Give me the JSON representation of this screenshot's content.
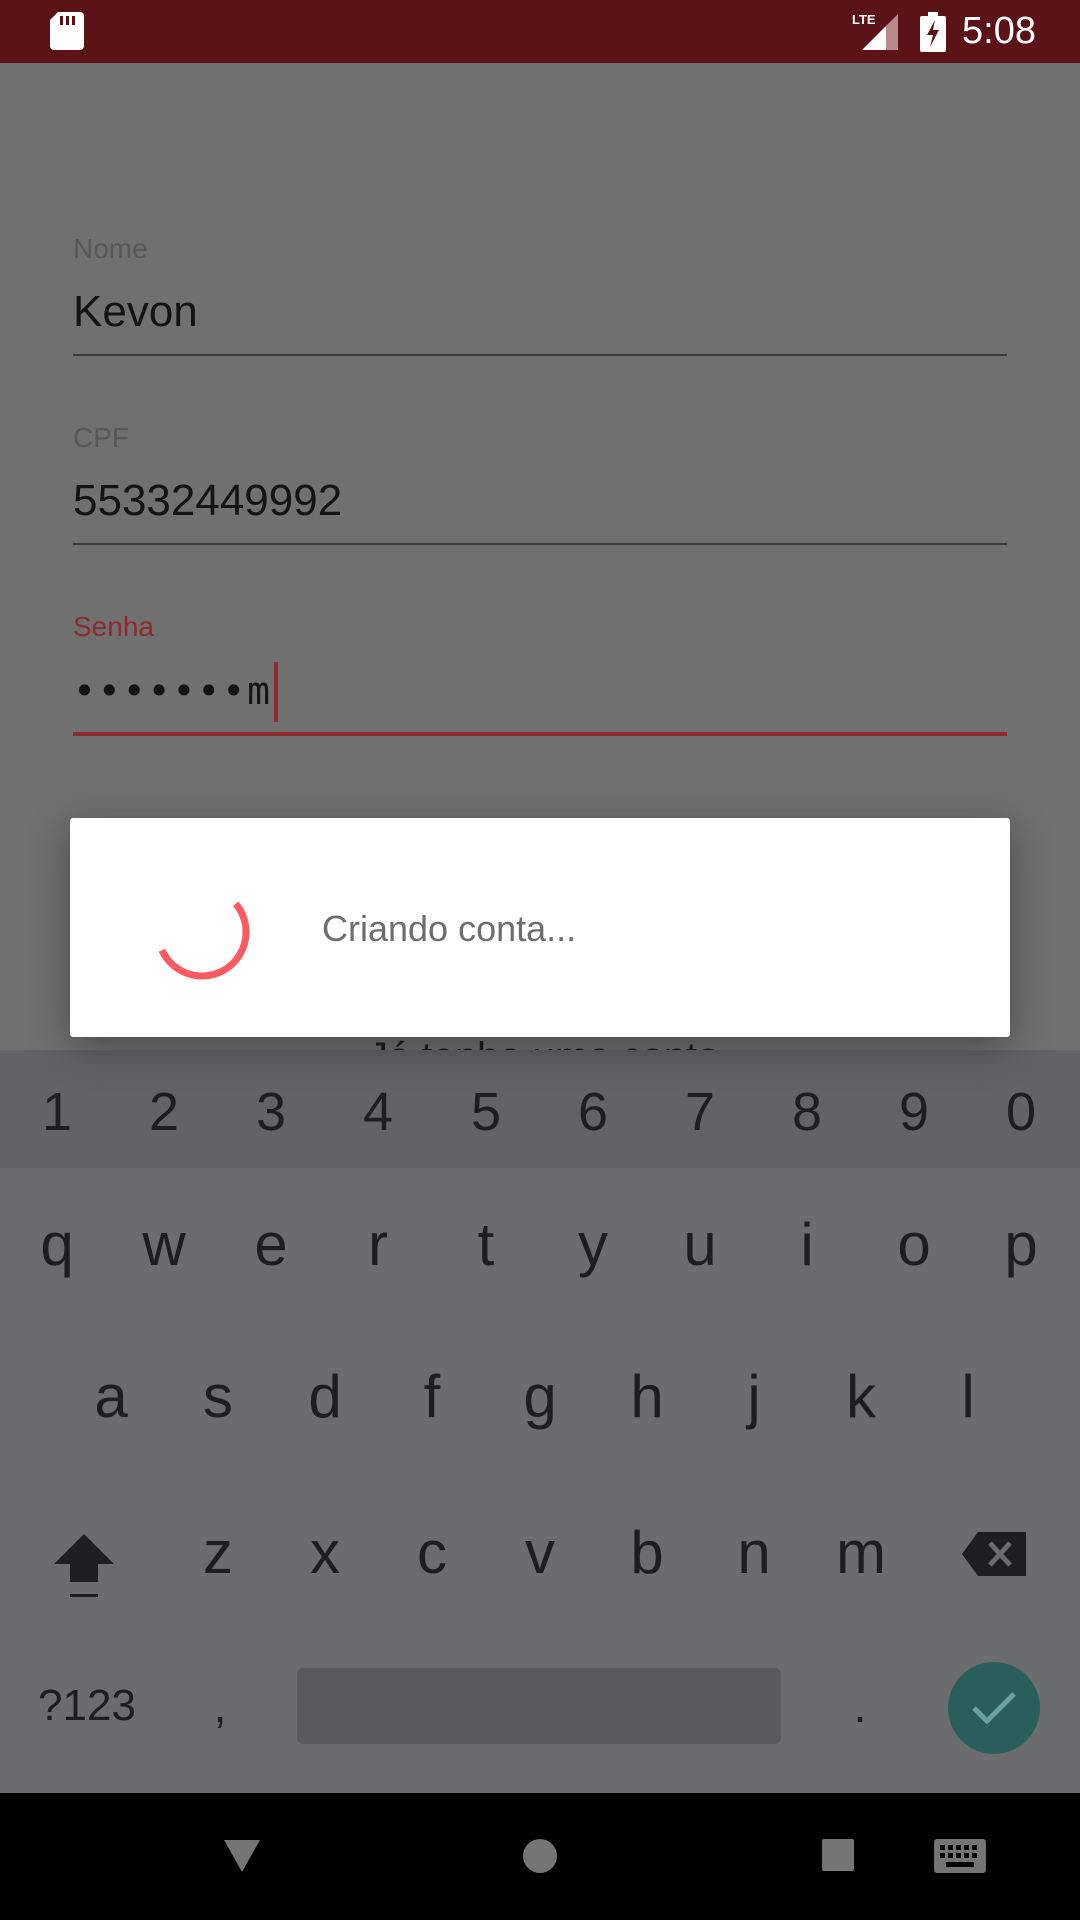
{
  "status_bar": {
    "network": "LTE",
    "time": "5:08",
    "icons": [
      "sd-card-icon",
      "lte-signal-icon",
      "battery-charging-icon"
    ]
  },
  "form": {
    "nome": {
      "label": "Nome",
      "value": "Kevon"
    },
    "cpf": {
      "label": "CPF",
      "value": "55332449992"
    },
    "senha": {
      "label": "Senha",
      "masked": "•••••••",
      "last_char": "m"
    },
    "link_behind": "Já tenho uma conta"
  },
  "dialog": {
    "message": "Criando conta...",
    "spinner_color": "#ff5a5f"
  },
  "keyboard": {
    "number_row": [
      "1",
      "2",
      "3",
      "4",
      "5",
      "6",
      "7",
      "8",
      "9",
      "0"
    ],
    "row1": [
      "q",
      "w",
      "e",
      "r",
      "t",
      "y",
      "u",
      "i",
      "o",
      "p"
    ],
    "row2": [
      "a",
      "s",
      "d",
      "f",
      "g",
      "h",
      "j",
      "k",
      "l"
    ],
    "row3": [
      "z",
      "x",
      "c",
      "v",
      "b",
      "n",
      "m"
    ],
    "symbols_label": "?123",
    "comma": ",",
    "period": ".",
    "icons": [
      "shift-icon",
      "backspace-icon",
      "check-icon"
    ]
  },
  "nav_bar": {
    "icons": [
      "back-icon",
      "home-icon",
      "recents-icon",
      "keyboard-switch-icon"
    ]
  },
  "colors": {
    "status_bar": "#5b1317",
    "accent": "#8e2a2c",
    "dim_overlay": "#707070",
    "enter_key": "#2a5e5a"
  }
}
